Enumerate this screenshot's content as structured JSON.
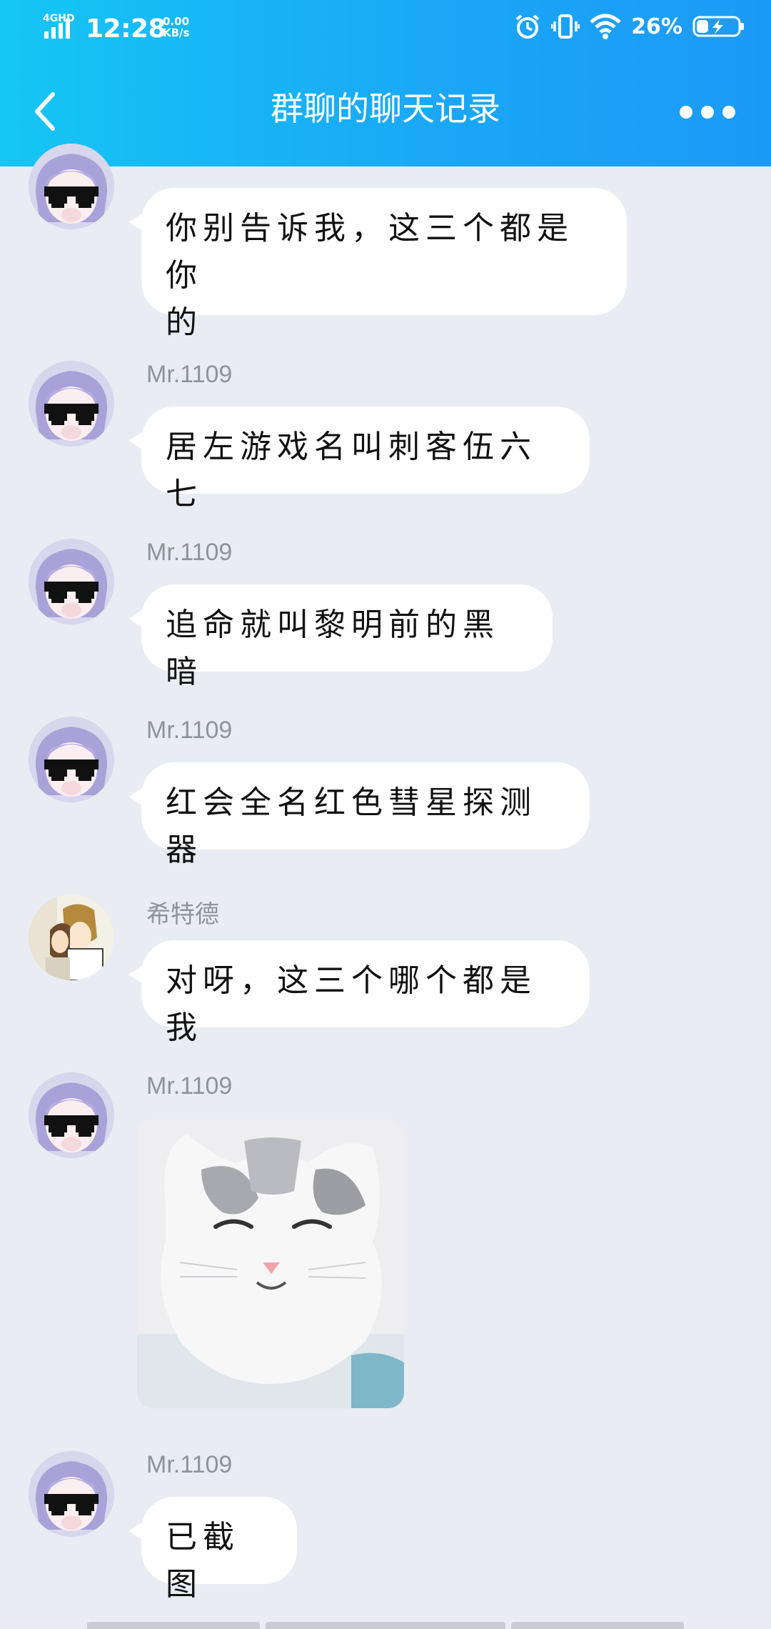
{
  "status_bar": {
    "network": "4GHD",
    "time": "12:28",
    "speed_value": "0.00",
    "speed_unit": "KB/s",
    "battery_percent": "26%",
    "battery_level": 0.26
  },
  "header": {
    "title": "群聊的聊天记录"
  },
  "colors": {
    "header_start": "#15c6f4",
    "header_end": "#1b9af5",
    "background": "#e9ecf3",
    "bubble": "#ffffff",
    "sender_name": "#8e939d"
  },
  "messages": [
    {
      "sender": "",
      "text_line1": "你别告诉我，这三个都是你",
      "text_line2": "的",
      "avatar": "anime-sunglasses-avatar"
    },
    {
      "sender": "Mr.1109",
      "text": "居左游戏名叫刺客伍六七",
      "avatar": "anime-sunglasses-avatar"
    },
    {
      "sender": "Mr.1109",
      "text": "追命就叫黎明前的黑暗",
      "avatar": "anime-sunglasses-avatar"
    },
    {
      "sender": "Mr.1109",
      "text": "红会全名红色彗星探测器",
      "avatar": "anime-sunglasses-avatar"
    },
    {
      "sender": "希特德",
      "text": "对呀，这三个哪个都是我",
      "avatar": "manga-couple-avatar"
    },
    {
      "sender": "Mr.1109",
      "image": "smiling-cat-sticker",
      "avatar": "anime-sunglasses-avatar"
    },
    {
      "sender": "Mr.1109",
      "text": "已截图",
      "avatar": "anime-sunglasses-avatar"
    }
  ]
}
